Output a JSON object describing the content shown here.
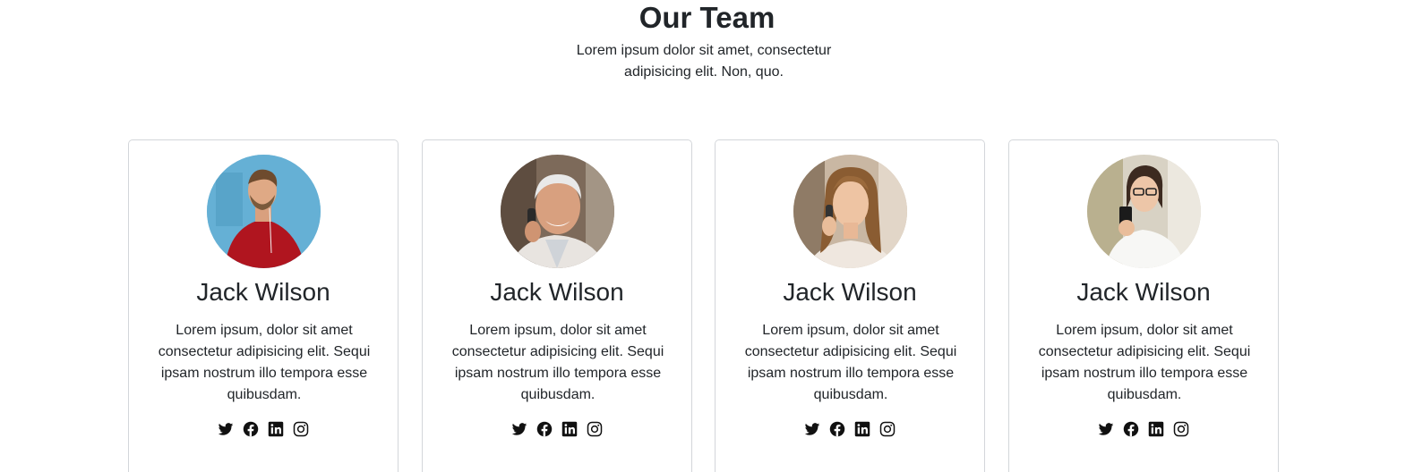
{
  "header": {
    "title": "Our Team",
    "subtitle": "Lorem ipsum dolor sit amet, consectetur adipisicing elit. Non, quo."
  },
  "team": [
    {
      "name": "Jack Wilson",
      "bio": "Lorem ipsum, dolor sit amet consectetur adipisicing elit. Sequi ipsam nostrum illo tempora esse quibusdam.",
      "photo": "man-red-sweater-photo",
      "socials": [
        "twitter-icon",
        "facebook-icon",
        "linkedin-icon",
        "instagram-icon"
      ]
    },
    {
      "name": "Jack Wilson",
      "bio": "Lorem ipsum, dolor sit amet consectetur adipisicing elit. Sequi ipsam nostrum illo tempora esse quibusdam.",
      "photo": "older-man-phone-photo",
      "socials": [
        "twitter-icon",
        "facebook-icon",
        "linkedin-icon",
        "instagram-icon"
      ]
    },
    {
      "name": "Jack Wilson",
      "bio": "Lorem ipsum, dolor sit amet consectetur adipisicing elit. Sequi ipsam nostrum illo tempora esse quibusdam.",
      "photo": "woman-phone-photo",
      "socials": [
        "twitter-icon",
        "facebook-icon",
        "linkedin-icon",
        "instagram-icon"
      ]
    },
    {
      "name": "Jack Wilson",
      "bio": "Lorem ipsum, dolor sit amet consectetur adipisicing elit. Sequi ipsam nostrum illo tempora esse quibusdam.",
      "photo": "woman-glasses-phone-photo",
      "socials": [
        "twitter-icon",
        "facebook-icon",
        "linkedin-icon",
        "instagram-icon"
      ]
    }
  ],
  "colors": {
    "text": "#212529",
    "card_border": "#d3d6da",
    "icon": "#111111"
  }
}
